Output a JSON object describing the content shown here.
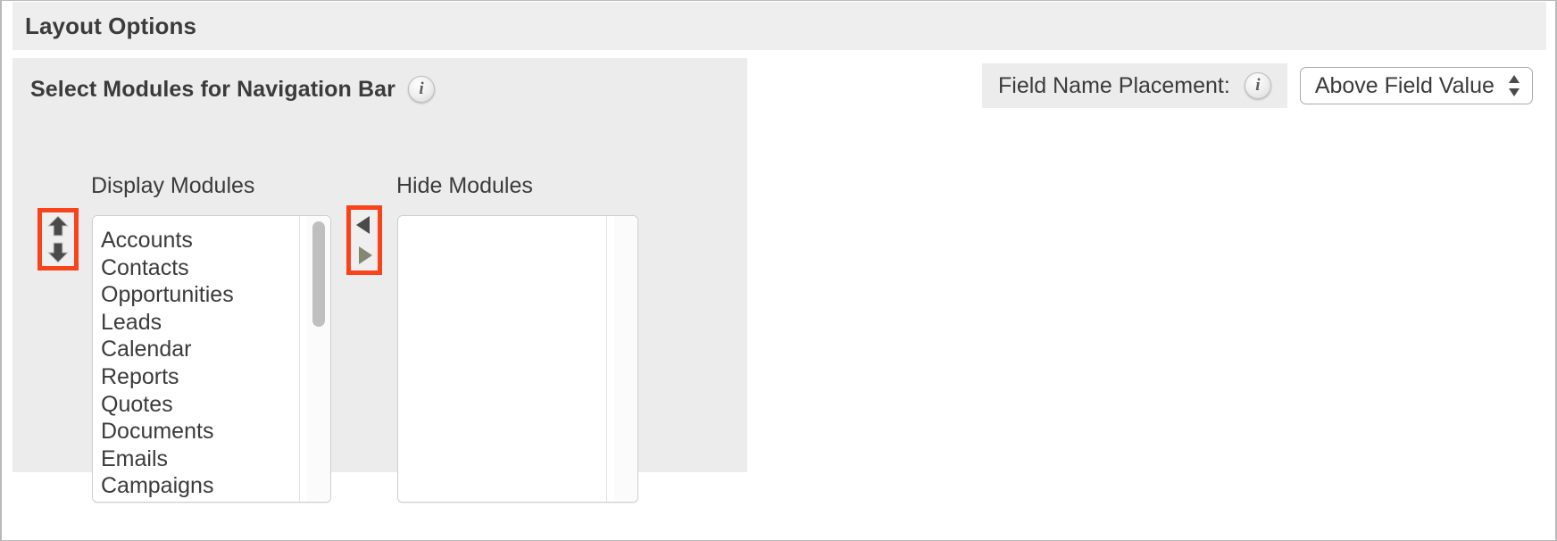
{
  "panel": {
    "header_title": "Layout Options"
  },
  "modules": {
    "section_title": "Select Modules for Navigation Bar",
    "info_icon": "info-icon",
    "display_label": "Display Modules",
    "hide_label": "Hide Modules",
    "display_items": [
      "Accounts",
      "Contacts",
      "Opportunities",
      "Leads",
      "Calendar",
      "Reports",
      "Quotes",
      "Documents",
      "Emails",
      "Campaigns"
    ],
    "hide_items": [],
    "order_controls": {
      "up_icon": "arrow-up-icon",
      "down_icon": "arrow-down-icon"
    },
    "move_controls": {
      "left_icon": "arrow-left-icon",
      "right_icon": "arrow-right-icon"
    }
  },
  "field_placement": {
    "label": "Field Name Placement:",
    "info_icon": "info-icon",
    "selected_value": "Above Field Value",
    "stepper_icon": "updown-stepper-icon"
  },
  "colors": {
    "highlight": "#f9431b",
    "panel_bg": "#ececec",
    "header_bg": "#eeeeee",
    "text": "#3b3b3b",
    "arrow_dark": "#4a4a4a",
    "arrow_olive": "#848771"
  }
}
